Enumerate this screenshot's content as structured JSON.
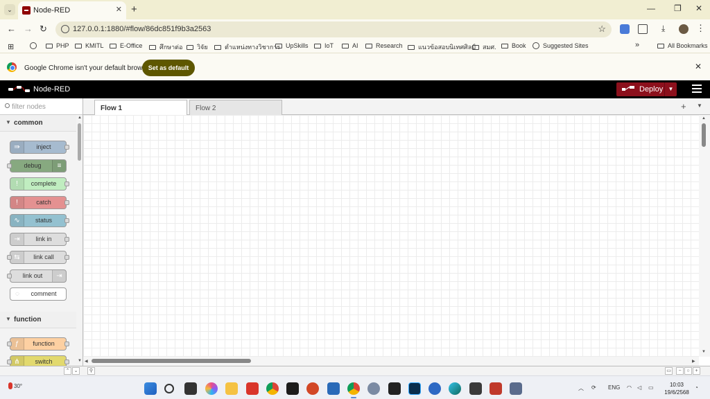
{
  "browser": {
    "tab_title": "Node-RED",
    "url": "127.0.0.1:1880/#flow/86dc851f9b3a2563",
    "bookmarks": [
      "PHP",
      "KMITL",
      "E-Office",
      "ศึกษาต่อ",
      "วิจัย",
      "ตำแหน่งทางวิชาการ",
      "UpSkills",
      "IoT",
      "AI",
      "Research",
      "แนวข้อสอบนิเทศศิลป์",
      "สมศ.",
      "Book",
      "Suggested Sites"
    ],
    "all_bookmarks": "All Bookmarks",
    "infobar_text": "Google Chrome isn't your default browser",
    "set_default_label": "Set as default"
  },
  "app": {
    "title": "Node-RED",
    "deploy_label": "Deploy"
  },
  "palette": {
    "filter_placeholder": "filter nodes",
    "categories": [
      {
        "label": "common",
        "nodes": [
          {
            "label": "inject",
            "color": "#a6bbcf",
            "icon_side": "left",
            "icon": "⇛",
            "in": false,
            "out": true
          },
          {
            "label": "debug",
            "color": "#87a980",
            "icon_side": "right",
            "icon": "≡",
            "in": true,
            "out": false
          },
          {
            "label": "complete",
            "color": "#c0edc0",
            "icon_side": "left",
            "icon": "!",
            "in": false,
            "out": true
          },
          {
            "label": "catch",
            "color": "#e49191",
            "icon_side": "left",
            "icon": "!",
            "in": false,
            "out": true
          },
          {
            "label": "status",
            "color": "#94c1d0",
            "icon_side": "left",
            "icon": "∿",
            "in": false,
            "out": true
          },
          {
            "label": "link in",
            "color": "#dddddd",
            "icon_side": "left",
            "icon": "⇥",
            "in": false,
            "out": true
          },
          {
            "label": "link call",
            "color": "#dddddd",
            "icon_side": "left",
            "icon": "⇆",
            "in": true,
            "out": true
          },
          {
            "label": "link out",
            "color": "#dddddd",
            "icon_side": "right",
            "icon": "⇥",
            "in": true,
            "out": false
          },
          {
            "label": "comment",
            "color": "#ffffff",
            "icon_side": "left",
            "icon": "◌",
            "in": false,
            "out": false
          }
        ]
      },
      {
        "label": "function",
        "nodes": [
          {
            "label": "function",
            "color": "#fdd0a2",
            "icon_side": "left",
            "icon": "ƒ",
            "in": true,
            "out": true
          },
          {
            "label": "switch",
            "color": "#e2d96e",
            "icon_side": "left",
            "icon": "⋔",
            "in": true,
            "out": true
          }
        ]
      }
    ]
  },
  "workspace": {
    "tabs": [
      {
        "label": "Flow 1",
        "active": true
      },
      {
        "label": "Flow 2",
        "active": false
      }
    ]
  },
  "taskbar": {
    "weather": "30°",
    "language": "ENG",
    "time": "10:03",
    "date": "19/6/2568"
  }
}
